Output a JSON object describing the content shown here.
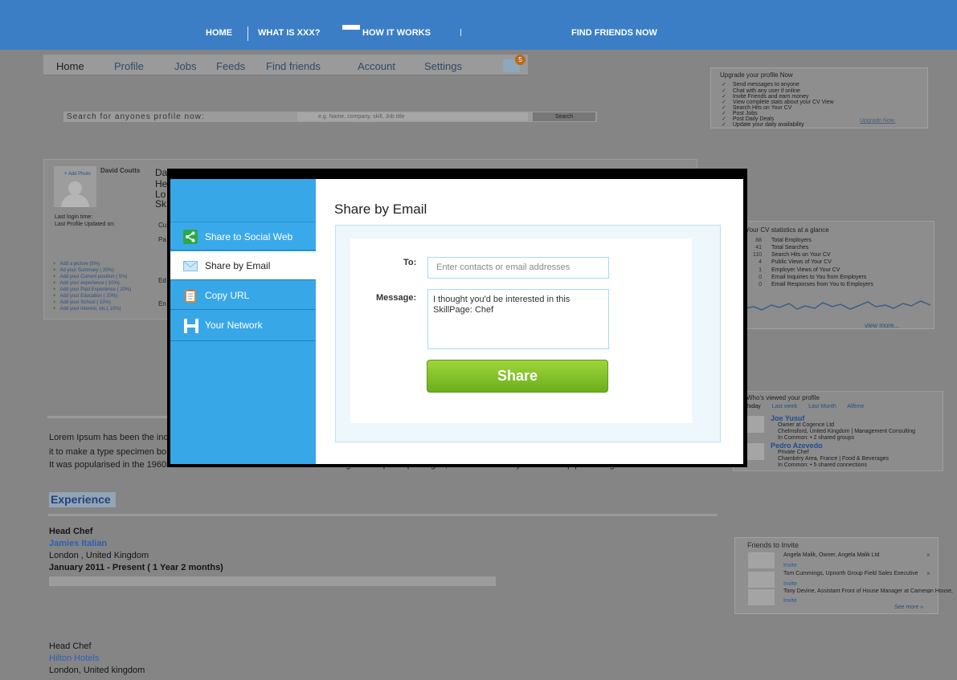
{
  "topnav": {
    "home": "HOME",
    "what": "WHAT IS XXX?",
    "how": "HOW IT WORKS",
    "find": "FIND FRIENDS NOW"
  },
  "tabs": {
    "home": "Home",
    "profile": "Profile",
    "jobs": "Jobs",
    "feeds": "Feeds",
    "find_friends": "Find friends",
    "account": "Account",
    "settings": "Settings",
    "mail_count": "5"
  },
  "search": {
    "label": "Search for anyones profile now:",
    "placeholder": "e.g. Name, company, skill, Job title",
    "button": "Search"
  },
  "profile": {
    "add_photo": "+ Add Photo",
    "name": "David Coutts",
    "big_name_lines": [
      "Da",
      "He",
      "Lo",
      "Sk"
    ],
    "last_login": "Last login time:",
    "last_updated": "Last Profile Updated on:",
    "side_letters": [
      "Cu",
      "Pa",
      "Ed",
      "En"
    ],
    "completion": [
      "Add a picture (5%)",
      "Ad your Summary ( 20%)",
      "Add your Current position ( 5%)",
      "Add your experience ( 10%)",
      "Add your Past Experience ( 20%)",
      "Add your Education ( 20%)",
      "Add your School ( 10%)",
      "Add your interest, etc.( 10%)"
    ]
  },
  "upgrade": {
    "heading": "Upgrade your profile Now",
    "items": [
      "Send messages to anyone",
      "Chat with any user if online",
      "Invite Friends and earn money",
      "View complete stats about your CV View",
      "Search Hits on Your CV",
      "Post Jobs",
      "Post Daily Deals",
      "Update your daily availability"
    ],
    "link": "Upgrade Now."
  },
  "stats": {
    "heading": "Your CV statistics at a glance",
    "rows": [
      {
        "n": "88",
        "label": "Total Employers"
      },
      {
        "n": "41",
        "label": "Total Searches"
      },
      {
        "n": "110",
        "label": "Search Hits on Your CV"
      },
      {
        "n": "4",
        "label": "Public Views of Your CV"
      },
      {
        "n": "1",
        "label": "Employer Views of Your CV"
      },
      {
        "n": "0",
        "label": "Email Inquiries to You from Employers"
      },
      {
        "n": "0",
        "label": "Email Responses from You to Employers"
      }
    ],
    "view_more": "view more..."
  },
  "viewed": {
    "heading": "Who's viewed your profile",
    "tabs": [
      "Today",
      "Last week",
      "Last Month",
      "Alltime"
    ],
    "people": [
      {
        "name": "Joe Yusuf",
        "title": "Owner at Cogence Ltd",
        "location": "Chelmsford, United Kingdom | Management Consulting",
        "common": "In Common: • 2 shared groups"
      },
      {
        "name": "Pedro Azevedo",
        "title": "Private Chef",
        "location": "Chambéry Area, France | Food & Beverages",
        "common": "In Common: • 5 shared connections"
      }
    ]
  },
  "friends": {
    "heading": "Friends to Invite",
    "people": [
      {
        "name": "Angela Malik, Owner, Angela Malik Ltd",
        "invite": "Invite"
      },
      {
        "name": "Tom Cummings, Upnorth Group Field Sales Executive",
        "invite": "Invite"
      },
      {
        "name": "Tony Devine, Assistant Front of House Manager at Cameron House,",
        "invite": "Invite"
      }
    ],
    "see_more": "See more »"
  },
  "lorem": {
    "line1": "Lorem Ipsum has been the ind",
    "line2": " it to make a type specimen bo",
    "line3": "It was popularised in the 1960s with the release of Letraset sheets containing Lorem Ipsum passages, and more recently with desktop publishing."
  },
  "experience": {
    "heading": "Experience",
    "job1": {
      "title": "Head Chef",
      "company": "Jamies Italian",
      "location": "London , United Kingdom",
      "dates": "January 2011 - Present ( 1 Year 2 months)"
    },
    "job2": {
      "title": "Head Chef",
      "company": "Hilton Hotels",
      "location": "London, United kingdom"
    }
  },
  "modal": {
    "close": "×",
    "menu": [
      {
        "label": "Share to Social Web",
        "icon": "share-icon"
      },
      {
        "label": "Share by Email",
        "icon": "envelope-icon"
      },
      {
        "label": "Copy URL",
        "icon": "clipboard-icon"
      },
      {
        "label": "Your Network",
        "icon": "network-logo-icon"
      }
    ],
    "title": "Share by Email",
    "to_label": "To:",
    "to_placeholder": "Enter contacts or email addresses",
    "message_label": "Message:",
    "message_value": "I thought you'd be interested in this SkillPage: Chef",
    "share_button": "Share"
  },
  "colors": {
    "topbar": "#3c7ec6",
    "menu": "#38a7e8",
    "share_green": "#7ec12a",
    "close_orange": "#e0571f"
  }
}
